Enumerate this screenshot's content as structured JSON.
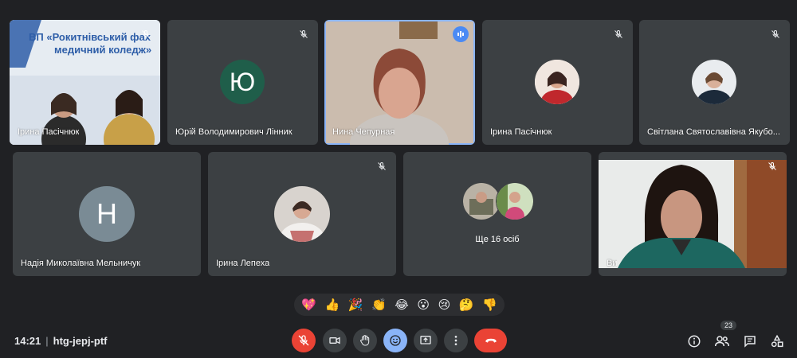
{
  "participants": {
    "p1": {
      "name": "Ірина Пасічнюк",
      "banner_line1": "ВП «Рокитнівський фах",
      "banner_line2": "медичний коледж»"
    },
    "p2": {
      "name": "Юрій Володимирович Лінник",
      "initial": "Ю",
      "avatar_color": "#1f5e4a"
    },
    "p3": {
      "name": "Нина Чепурная"
    },
    "p4": {
      "name": "Ірина Пасічнюк"
    },
    "p5": {
      "name": "Світлана Святославівна Якубо..."
    },
    "p6": {
      "name": "Надія Миколаївна Мельничук",
      "initial": "Н",
      "avatar_color": "#7a8b95"
    },
    "p7": {
      "name": "Ірина Лепеха"
    },
    "p8": {
      "label": "Ще 16 осіб"
    },
    "p9": {
      "name": "Ви"
    }
  },
  "reactions": [
    "💖",
    "👍",
    "🎉",
    "👏",
    "😂",
    "😮",
    "😢",
    "🤔",
    "👎"
  ],
  "meeting": {
    "time": "14:21",
    "separator": "|",
    "code": "htg-jepj-ptf"
  },
  "people_count": "23",
  "colors": {
    "end_call": "#ea4335",
    "mic_off": "#ea4335",
    "active_reaction": "#8ab4f8",
    "speaking": "#4a8af4"
  }
}
